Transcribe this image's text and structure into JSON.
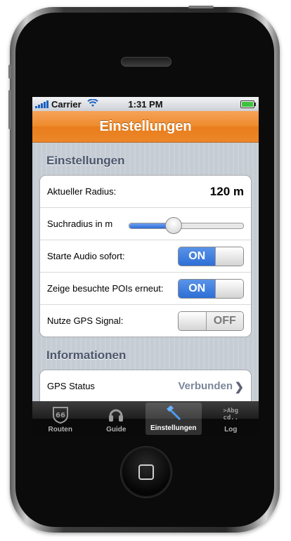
{
  "status": {
    "carrier": "Carrier",
    "time": "1:31 PM"
  },
  "nav": {
    "title": "Einstellungen"
  },
  "sections": [
    {
      "title": "Einstellungen"
    },
    {
      "title": "Informationen"
    }
  ],
  "settings": {
    "radius_label": "Aktueller Radius:",
    "radius_value": "120 m",
    "search_label": "Suchradius in m",
    "slider_fraction": 0.38,
    "audio_label": "Starte Audio sofort:",
    "audio_state": "ON",
    "pois_label": "Zeige besuchte POIs erneut:",
    "pois_state": "ON",
    "gps_label": "Nutze GPS Signal:",
    "gps_state": "OFF"
  },
  "info": {
    "gps_status_label": "GPS Status",
    "gps_status_value": "Verbunden"
  },
  "tabs": [
    {
      "label": "Routen",
      "icon": "route66-icon"
    },
    {
      "label": "Guide",
      "icon": "headphones-icon"
    },
    {
      "label": "Einstellungen",
      "icon": "hammer-icon",
      "active": true
    },
    {
      "label": "Log",
      "icon": "terminal-log-icon",
      "icon_text_1": ">Abg",
      "icon_text_2": "cd.."
    }
  ]
}
